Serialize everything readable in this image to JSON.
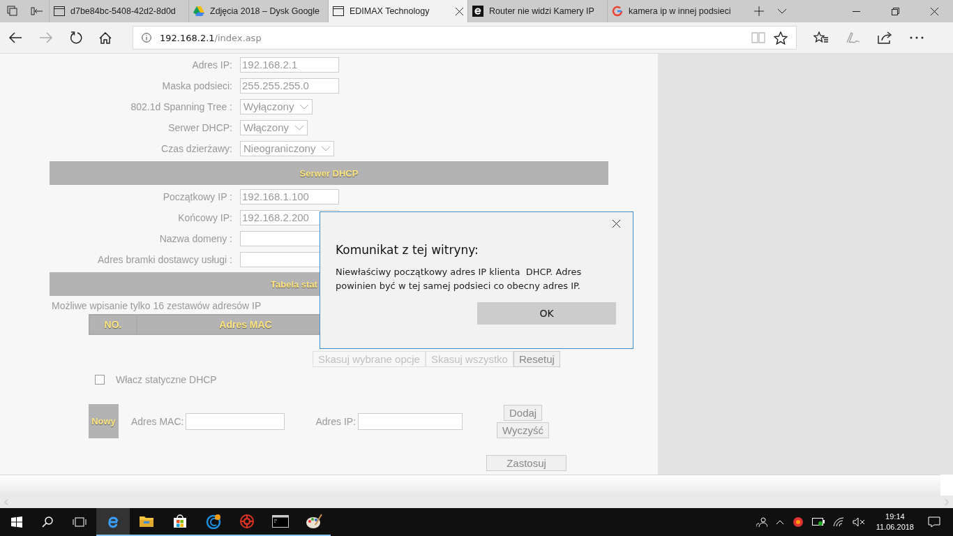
{
  "tabs": [
    {
      "kind": "page",
      "title": "d7be84bc-5408-42d2-8d0d",
      "selected": false
    },
    {
      "kind": "drive",
      "title": "Zdjęcia 2018 – Dysk Google",
      "selected": false
    },
    {
      "kind": "page",
      "title": "EDIMAX Technology",
      "selected": true
    },
    {
      "kind": "edge",
      "title": "Router nie widzi Kamery IP",
      "selected": false
    },
    {
      "kind": "google",
      "title": "kamera ip w innej podsieci",
      "selected": false
    }
  ],
  "address": {
    "host": "192.168.2.1",
    "path": "/index.asp"
  },
  "lan_rows": [
    {
      "kind": "input",
      "label": "Adres IP:",
      "value": "192.168.2.1"
    },
    {
      "kind": "input",
      "label": "Maska podsieci:",
      "value": "255.255.255.0"
    },
    {
      "kind": "select",
      "label": "802.1d Spanning Tree :",
      "value": "Wyłączony"
    },
    {
      "kind": "select",
      "label": "Serwer DHCP:",
      "value": "Włączony"
    },
    {
      "kind": "select",
      "label": "Czas dzierżawy:",
      "value": "Nieograniczony"
    }
  ],
  "dhcp_header": "Serwer DHCP",
  "dhcp_rows": [
    {
      "kind": "input",
      "label": "Początkowy IP :",
      "value": "192.168.1.100"
    },
    {
      "kind": "input",
      "label": "Końcowy IP:",
      "value": "192.168.2.200"
    },
    {
      "kind": "input",
      "label": "Nazwa domeny :"
    },
    {
      "kind": "input",
      "label": "Adres bramki dostawcy usługi :"
    }
  ],
  "static_header": "Tabela stat",
  "note": "Możliwe wpisanie tylko 16 zestawów adresów IP",
  "table_columns": [
    "NO.",
    "Adres MAC"
  ],
  "table_buttons": [
    {
      "label": "Skasuj wybrane opcje",
      "disabled": true
    },
    {
      "label": "Skasuj wszystko",
      "disabled": true
    },
    {
      "label": "Resetuj",
      "disabled": false
    }
  ],
  "static_enable": {
    "label": "Włacz statyczne DHCP",
    "checked": false
  },
  "new_entry": {
    "badge": "Nowy",
    "mac_label": "Adres MAC:",
    "ip_label": "Adres IP:",
    "add": "Dodaj",
    "clear": "Wyczyść"
  },
  "apply": "Zastosuj",
  "dialog": {
    "title": "Komunikat z tej witryny:",
    "message": "Niewłaściwy początkowy adres IP klienta  DHCP. Adres powinien być w tej samej podsieci co obecny adres IP.",
    "ok": "OK"
  },
  "taskbar": {
    "time": "19:14",
    "date": "11.06.2018"
  }
}
